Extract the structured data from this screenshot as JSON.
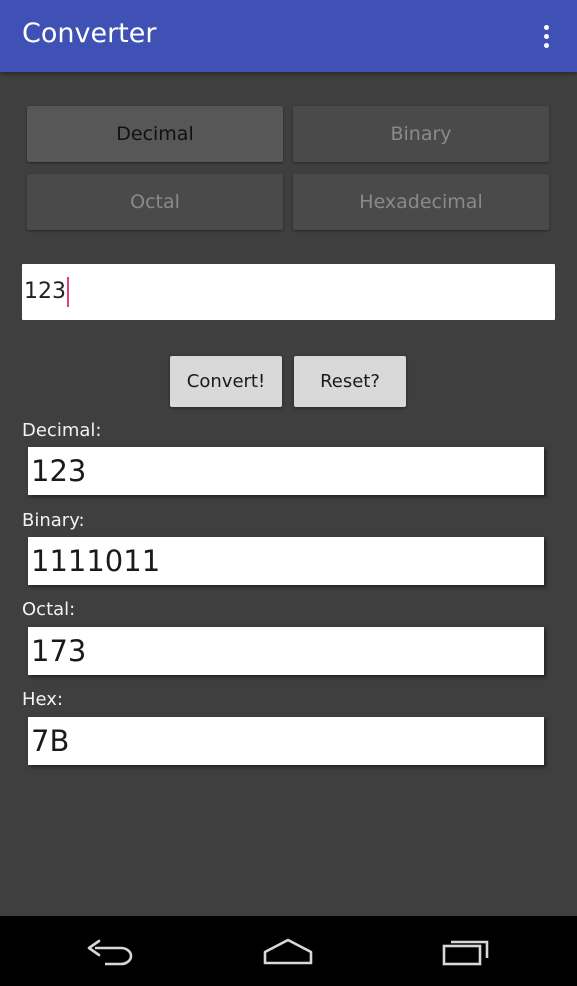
{
  "app": {
    "title": "Converter",
    "overflow_icon": "more-vert-icon",
    "accent_color": "#3f51b5"
  },
  "modes": {
    "decimal_label": "Decimal",
    "binary_label": "Binary",
    "octal_label": "Octal",
    "hex_label": "Hexadecimal",
    "selected": "Decimal"
  },
  "input": {
    "value": "123",
    "cursor_color": "#e2407a"
  },
  "actions": {
    "convert_label": "Convert!",
    "reset_label": "Reset?"
  },
  "results": [
    {
      "label": "Decimal:",
      "value": "123"
    },
    {
      "label": "Binary:",
      "value": "1111011"
    },
    {
      "label": "Octal:",
      "value": "173"
    },
    {
      "label": "Hex:",
      "value": "7B"
    }
  ],
  "navbar": {
    "back_icon": "back-icon",
    "home_icon": "home-icon",
    "recents_icon": "recents-icon"
  }
}
